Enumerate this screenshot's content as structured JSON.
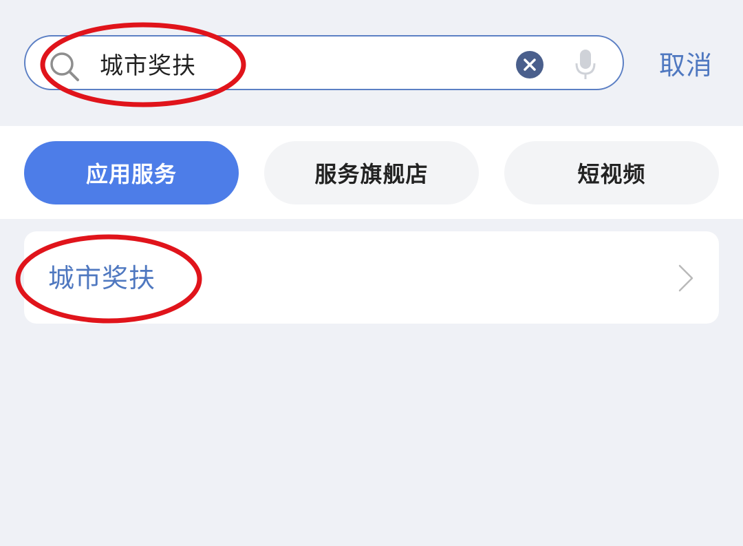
{
  "search": {
    "query": "城市奖扶",
    "cancel_label": "取消"
  },
  "tabs": [
    {
      "label": "应用服务",
      "active": true
    },
    {
      "label": "服务旗舰店",
      "active": false
    },
    {
      "label": "短视频",
      "active": false
    }
  ],
  "results": [
    {
      "label": "城市奖扶"
    }
  ],
  "colors": {
    "accent": "#4d7de8",
    "link": "#4f78c0",
    "annotation": "#e0141b"
  },
  "icons": {
    "search": "search-icon",
    "clear": "clear-icon",
    "mic": "microphone-icon",
    "chevron": "chevron-right-icon"
  }
}
